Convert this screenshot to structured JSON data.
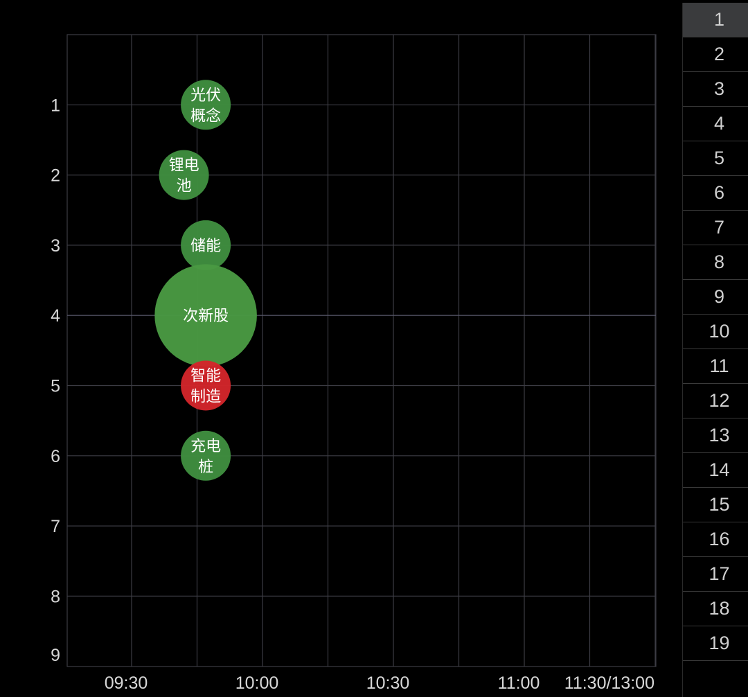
{
  "chart_data": {
    "type": "scatter",
    "x_ticks": [
      "09:30",
      "10:00",
      "10:30",
      "11:00",
      "11:30/13:00"
    ],
    "y_ticks": [
      "1",
      "2",
      "3",
      "4",
      "5",
      "6",
      "7",
      "8",
      "9"
    ],
    "grid": true,
    "y_range": [
      0,
      9
    ],
    "points": [
      {
        "label": "光伏概念",
        "label_lines": [
          "光伏",
          "概念"
        ],
        "time": "09:47",
        "rank": 1,
        "size": 1.0,
        "color": "#3f8f3f"
      },
      {
        "label": "锂电池",
        "label_lines": [
          "锂电",
          "池"
        ],
        "time": "09:42",
        "rank": 2,
        "size": 1.0,
        "color": "#3f8f3f"
      },
      {
        "label": "储能",
        "label_lines": [
          "储能"
        ],
        "time": "09:47",
        "rank": 3,
        "size": 1.0,
        "color": "#3f8f3f"
      },
      {
        "label": "次新股",
        "label_lines": [
          "次新股"
        ],
        "time": "09:47",
        "rank": 4,
        "size": 2.05,
        "color": "#4a9a43"
      },
      {
        "label": "智能制造",
        "label_lines": [
          "智能",
          "制造"
        ],
        "time": "09:47",
        "rank": 5,
        "size": 1.0,
        "color": "#d3252b"
      },
      {
        "label": "充电桩",
        "label_lines": [
          "充电",
          "桩"
        ],
        "time": "09:47",
        "rank": 6,
        "size": 1.0,
        "color": "#3f8f3f"
      }
    ]
  },
  "rank_list": {
    "selected": "1",
    "items": [
      "1",
      "2",
      "3",
      "4",
      "5",
      "6",
      "7",
      "8",
      "9",
      "10",
      "11",
      "12",
      "13",
      "14",
      "15",
      "16",
      "17",
      "18",
      "19"
    ]
  },
  "colors": {
    "background": "#000000",
    "grid": "#3c3c44",
    "highlight_grid": "#5a5a6e",
    "axis_text": "#d8d8d8",
    "rising": "#d3252b",
    "falling": "#3f8f3f"
  }
}
